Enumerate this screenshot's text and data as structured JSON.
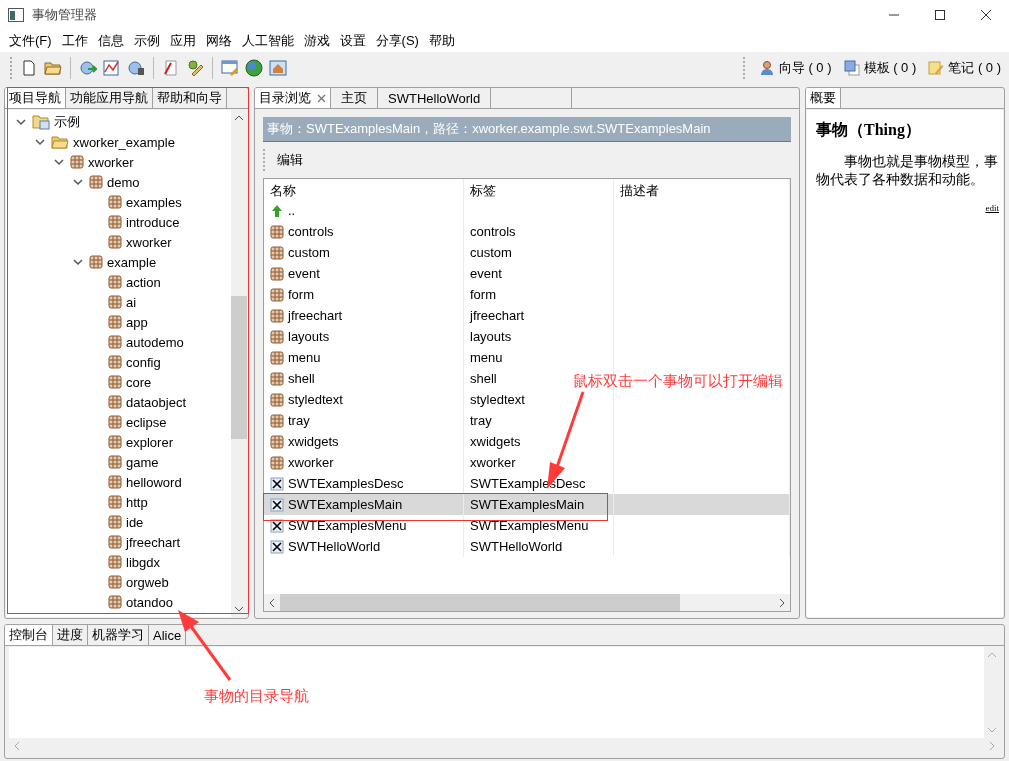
{
  "window": {
    "title": "事物管理器"
  },
  "menu": [
    "文件(F)",
    "工作",
    "信息",
    "示例",
    "应用",
    "网络",
    "人工智能",
    "游戏",
    "设置",
    "分享(S)",
    "帮助"
  ],
  "toolbar_right": [
    {
      "label": "向导 ( 0 )",
      "kind": "person"
    },
    {
      "label": "模板 ( 0 )",
      "kind": "template"
    },
    {
      "label": "笔记 ( 0 )",
      "kind": "note"
    }
  ],
  "left_panel": {
    "tabs": [
      {
        "label": "项目导航",
        "selected": true
      },
      {
        "label": "功能应用导航",
        "selected": false
      },
      {
        "label": "帮助和向导",
        "selected": false
      }
    ],
    "tree": [
      {
        "label": "示例",
        "kind": "category",
        "expanded": true,
        "children": [
          {
            "label": "xworker_example",
            "kind": "folder",
            "expanded": true,
            "children": [
              {
                "label": "xworker",
                "kind": "thing",
                "expanded": true,
                "children": [
                  {
                    "label": "demo",
                    "kind": "thing",
                    "expanded": true,
                    "children": [
                      {
                        "label": "examples",
                        "kind": "thing"
                      },
                      {
                        "label": "introduce",
                        "kind": "thing"
                      },
                      {
                        "label": "xworker",
                        "kind": "thing"
                      }
                    ]
                  },
                  {
                    "label": "example",
                    "kind": "thing",
                    "expanded": true,
                    "children": [
                      {
                        "label": "action",
                        "kind": "thing"
                      },
                      {
                        "label": "ai",
                        "kind": "thing"
                      },
                      {
                        "label": "app",
                        "kind": "thing"
                      },
                      {
                        "label": "autodemo",
                        "kind": "thing"
                      },
                      {
                        "label": "config",
                        "kind": "thing"
                      },
                      {
                        "label": "core",
                        "kind": "thing"
                      },
                      {
                        "label": "dataobject",
                        "kind": "thing"
                      },
                      {
                        "label": "eclipse",
                        "kind": "thing"
                      },
                      {
                        "label": "explorer",
                        "kind": "thing"
                      },
                      {
                        "label": "game",
                        "kind": "thing"
                      },
                      {
                        "label": "helloword",
                        "kind": "thing"
                      },
                      {
                        "label": "http",
                        "kind": "thing"
                      },
                      {
                        "label": "ide",
                        "kind": "thing"
                      },
                      {
                        "label": "jfreechart",
                        "kind": "thing"
                      },
                      {
                        "label": "libgdx",
                        "kind": "thing"
                      },
                      {
                        "label": "orgweb",
                        "kind": "thing"
                      },
                      {
                        "label": "otandoo",
                        "kind": "thing"
                      }
                    ]
                  }
                ]
              }
            ]
          }
        ]
      }
    ]
  },
  "center_panel": {
    "tabs": [
      {
        "label": "目录浏览",
        "selected": true,
        "closable": true
      },
      {
        "label": "主页",
        "selected": false,
        "closable": false
      },
      {
        "label": "SWTHelloWorld",
        "selected": false,
        "closable": false
      }
    ],
    "path": "事物：SWTExamplesMain，路径：xworker.example.swt.SWTExamplesMain",
    "toolbar_button": "编辑",
    "table": {
      "columns": [
        "名称",
        "标签",
        "描述者"
      ],
      "rows": [
        {
          "name": "..",
          "kind": "up",
          "selected": false
        },
        {
          "name": "controls",
          "label": "controls",
          "kind": "thing",
          "selected": false
        },
        {
          "name": "custom",
          "label": "custom",
          "kind": "thing",
          "selected": false
        },
        {
          "name": "event",
          "label": "event",
          "kind": "thing",
          "selected": false
        },
        {
          "name": "form",
          "label": "form",
          "kind": "thing",
          "selected": false
        },
        {
          "name": "jfreechart",
          "label": "jfreechart",
          "kind": "thing",
          "selected": false
        },
        {
          "name": "layouts",
          "label": "layouts",
          "kind": "thing",
          "selected": false
        },
        {
          "name": "menu",
          "label": "menu",
          "kind": "thing",
          "selected": false
        },
        {
          "name": "shell",
          "label": "shell",
          "kind": "thing",
          "selected": false
        },
        {
          "name": "styledtext",
          "label": "styledtext",
          "kind": "thing",
          "selected": false
        },
        {
          "name": "tray",
          "label": "tray",
          "kind": "thing",
          "selected": false
        },
        {
          "name": "xwidgets",
          "label": "xwidgets",
          "kind": "thing",
          "selected": false
        },
        {
          "name": "xworker",
          "label": "xworker",
          "kind": "thing",
          "selected": false
        },
        {
          "name": "SWTExamplesDesc",
          "label": "SWTExamplesDesc",
          "kind": "swt",
          "selected": false
        },
        {
          "name": "SWTExamplesMain",
          "label": "SWTExamplesMain",
          "kind": "swt",
          "selected": true
        },
        {
          "name": "SWTExamplesMenu",
          "label": "SWTExamplesMenu",
          "kind": "swt",
          "selected": false
        },
        {
          "name": "SWTHelloWorld",
          "label": "SWTHelloWorld",
          "kind": "swt",
          "selected": false
        }
      ]
    }
  },
  "right_panel": {
    "tabs": [
      {
        "label": "概要",
        "selected": true
      }
    ],
    "heading": "事物（Thing）",
    "body": "事物也就是事物模型，事物代表了各种数据和动能。",
    "link": "edit"
  },
  "bottom_panel": {
    "tabs": [
      {
        "label": "控制台",
        "selected": true
      },
      {
        "label": "进度",
        "selected": false
      },
      {
        "label": "机器学习",
        "selected": false
      },
      {
        "label": "Alice",
        "selected": false
      }
    ]
  },
  "annotations": [
    {
      "text": "鼠标双击一个事物可以打开编辑",
      "kind": "table"
    },
    {
      "text": "事物的目录导航",
      "kind": "tree"
    }
  ]
}
